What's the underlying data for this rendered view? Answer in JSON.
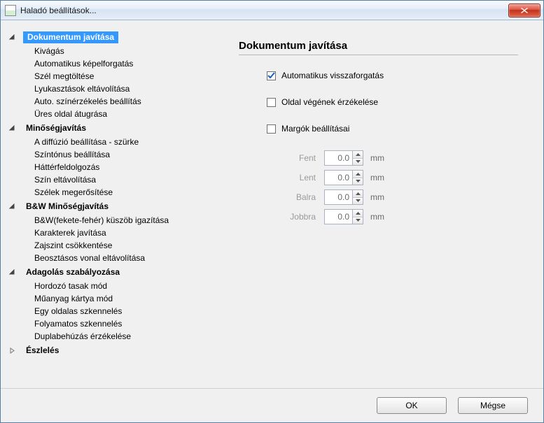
{
  "window": {
    "title": "Haladó beállítások..."
  },
  "tree": {
    "groups": [
      {
        "label": "Dokumentum javítása",
        "expanded": true,
        "selected": true,
        "items": [
          "Kivágás",
          "Automatikus képelforgatás",
          "Szél megtöltése",
          "Lyukasztások eltávolítása",
          "Auto. színérzékelés beállítás",
          "Üres oldal átugrása"
        ]
      },
      {
        "label": "Minőségjavítás",
        "expanded": true,
        "selected": false,
        "items": [
          "A diffúzió beállítása - szürke",
          "Színtónus beállítása",
          "Háttérfeldolgozás",
          "Szín eltávolítása",
          "Szélek megerősítése"
        ]
      },
      {
        "label": "B&W Minőségjavítás",
        "expanded": true,
        "selected": false,
        "items": [
          "B&W(fekete-fehér) küszöb igazítása",
          "Karakterek javítása",
          "Zajszint csökkentése",
          "Beosztásos vonal eltávolítása"
        ]
      },
      {
        "label": "Adagolás szabályozása",
        "expanded": true,
        "selected": false,
        "items": [
          "Hordozó tasak mód",
          "Műanyag kártya mód",
          "Egy oldalas szkennelés",
          "Folyamatos szkennelés",
          "Duplabehúzás érzékelése"
        ]
      },
      {
        "label": "Észlelés",
        "expanded": false,
        "selected": false,
        "items": []
      }
    ]
  },
  "detail": {
    "heading": "Dokumentum javítása",
    "options": [
      {
        "label": "Automatikus visszaforgatás",
        "checked": true
      },
      {
        "label": "Oldal végének érzékelése",
        "checked": false
      },
      {
        "label": "Margók beállításai",
        "checked": false
      }
    ],
    "margins": {
      "unit": "mm",
      "rows": [
        {
          "label": "Fent",
          "value": "0.0"
        },
        {
          "label": "Lent",
          "value": "0.0"
        },
        {
          "label": "Balra",
          "value": "0.0"
        },
        {
          "label": "Jobbra",
          "value": "0.0"
        }
      ]
    }
  },
  "footer": {
    "ok": "OK",
    "cancel": "Mégse"
  }
}
